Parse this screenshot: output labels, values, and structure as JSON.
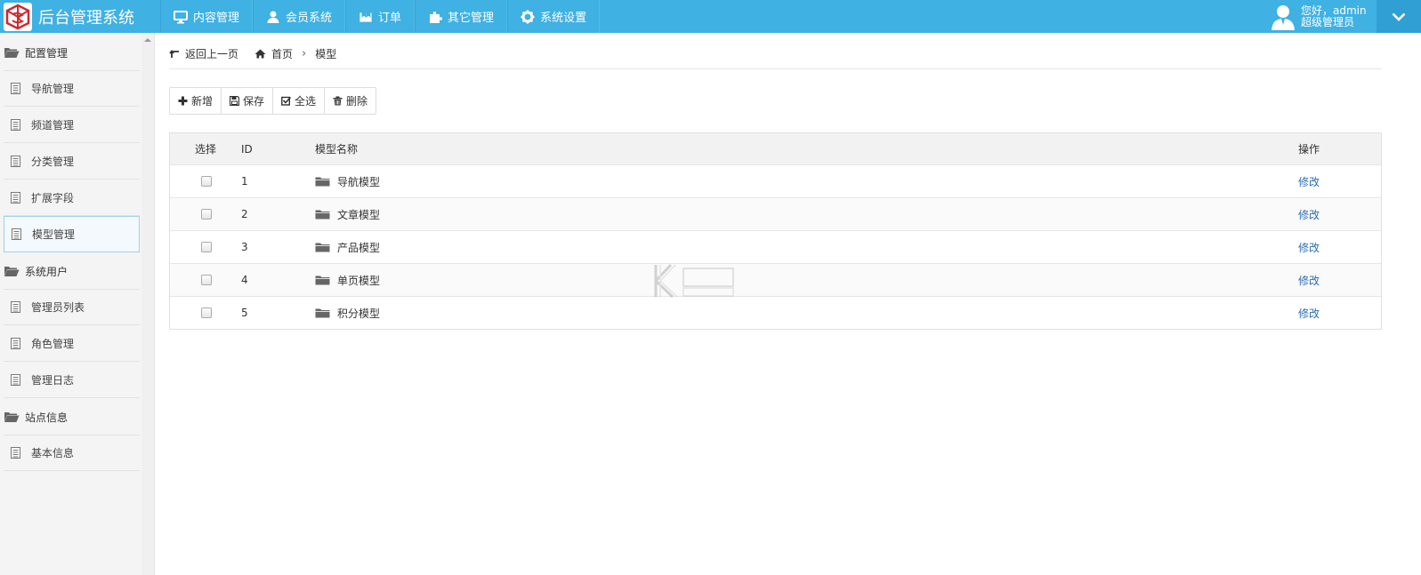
{
  "app": {
    "title": "后台管理系统"
  },
  "nav": [
    {
      "label": "内容管理",
      "icon": "monitor-icon"
    },
    {
      "label": "会员系统",
      "icon": "user-icon"
    },
    {
      "label": "订单",
      "icon": "order-icon"
    },
    {
      "label": "其它管理",
      "icon": "puzzle-icon"
    },
    {
      "label": "系统设置",
      "icon": "gear-icon"
    }
  ],
  "user": {
    "greeting": "您好，admin",
    "role": "超级管理员"
  },
  "sidebar": {
    "groups": [
      {
        "label": "配置管理",
        "items": [
          "导航管理",
          "频道管理",
          "分类管理",
          "扩展字段",
          "模型管理"
        ]
      },
      {
        "label": "系统用户",
        "items": [
          "管理员列表",
          "角色管理",
          "管理日志"
        ]
      },
      {
        "label": "站点信息",
        "items": [
          "基本信息"
        ]
      }
    ],
    "active_item": "模型管理"
  },
  "breadcrumb": {
    "back": "返回上一页",
    "home": "首页",
    "current": "模型"
  },
  "toolbar": {
    "add": "新增",
    "save": "保存",
    "select_all": "全选",
    "delete": "删除"
  },
  "table": {
    "headers": {
      "select": "选择",
      "id": "ID",
      "name": "模型名称",
      "action": "操作"
    },
    "rows": [
      {
        "id": "1",
        "name": "导航模型",
        "action": "修改"
      },
      {
        "id": "2",
        "name": "文章模型",
        "action": "修改"
      },
      {
        "id": "3",
        "name": "产品模型",
        "action": "修改"
      },
      {
        "id": "4",
        "name": "单页模型",
        "action": "修改"
      },
      {
        "id": "5",
        "name": "积分模型",
        "action": "修改"
      }
    ]
  },
  "colors": {
    "topbar": "#3fb1e3",
    "link": "#2a6cb4"
  }
}
